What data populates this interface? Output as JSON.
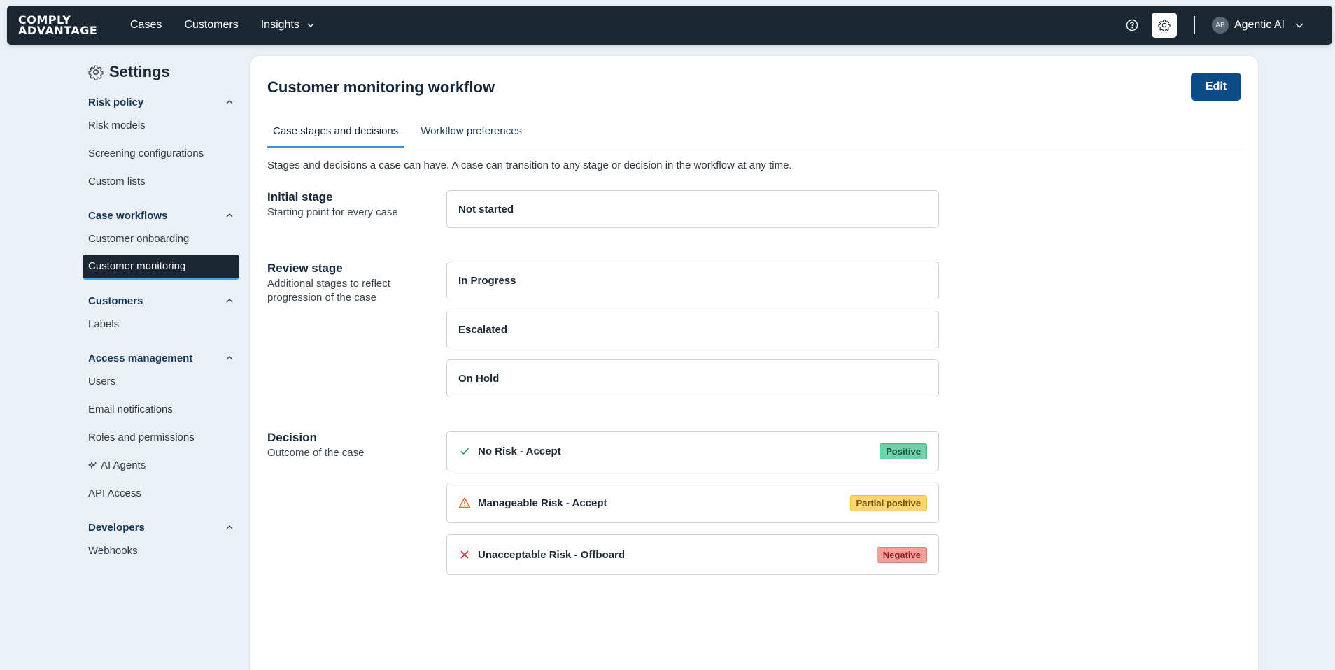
{
  "brand": {
    "logo_line1": "COMPLY",
    "logo_line2": "ADVANTAGE"
  },
  "nav": {
    "cases": "Cases",
    "customers": "Customers",
    "insights": "Insights"
  },
  "user": {
    "initials": "AB",
    "name": "Agentic AI"
  },
  "sidebar": {
    "title": "Settings",
    "groups": [
      {
        "label": "Risk policy",
        "items": [
          "Risk models",
          "Screening configurations",
          "Custom lists"
        ]
      },
      {
        "label": "Case workflows",
        "items": [
          "Customer onboarding",
          "Customer monitoring"
        ]
      },
      {
        "label": "Customers",
        "items": [
          "Labels"
        ]
      },
      {
        "label": "Access management",
        "items": [
          "Users",
          "Email notifications",
          "Roles and permissions",
          "AI Agents",
          "API Access"
        ]
      },
      {
        "label": "Developers",
        "items": [
          "Webhooks"
        ]
      }
    ]
  },
  "main": {
    "title": "Customer monitoring workflow",
    "edit_label": "Edit",
    "tabs": [
      "Case stages and decisions",
      "Workflow preferences"
    ],
    "intro": "Stages and decisions a case can have. A case can transition to any stage or decision in the workflow at any time.",
    "initial": {
      "heading": "Initial stage",
      "sub": "Starting point for every case",
      "value": "Not started"
    },
    "review": {
      "heading": "Review stage",
      "sub": "Additional stages to reflect progression of the case",
      "values": [
        "In Progress",
        "Escalated",
        "On Hold"
      ]
    },
    "decision": {
      "heading": "Decision",
      "sub": "Outcome of the case",
      "items": [
        {
          "label": "No Risk - Accept",
          "badge": "Positive",
          "icon": "check-icon",
          "color": "#2a9d6e"
        },
        {
          "label": "Manageable Risk - Accept",
          "badge": "Partial positive",
          "icon": "warning-icon",
          "color": "#e0622c"
        },
        {
          "label": "Unacceptable Risk - Offboard",
          "badge": "Negative",
          "icon": "cross-icon",
          "color": "#d22f2f"
        }
      ]
    }
  }
}
